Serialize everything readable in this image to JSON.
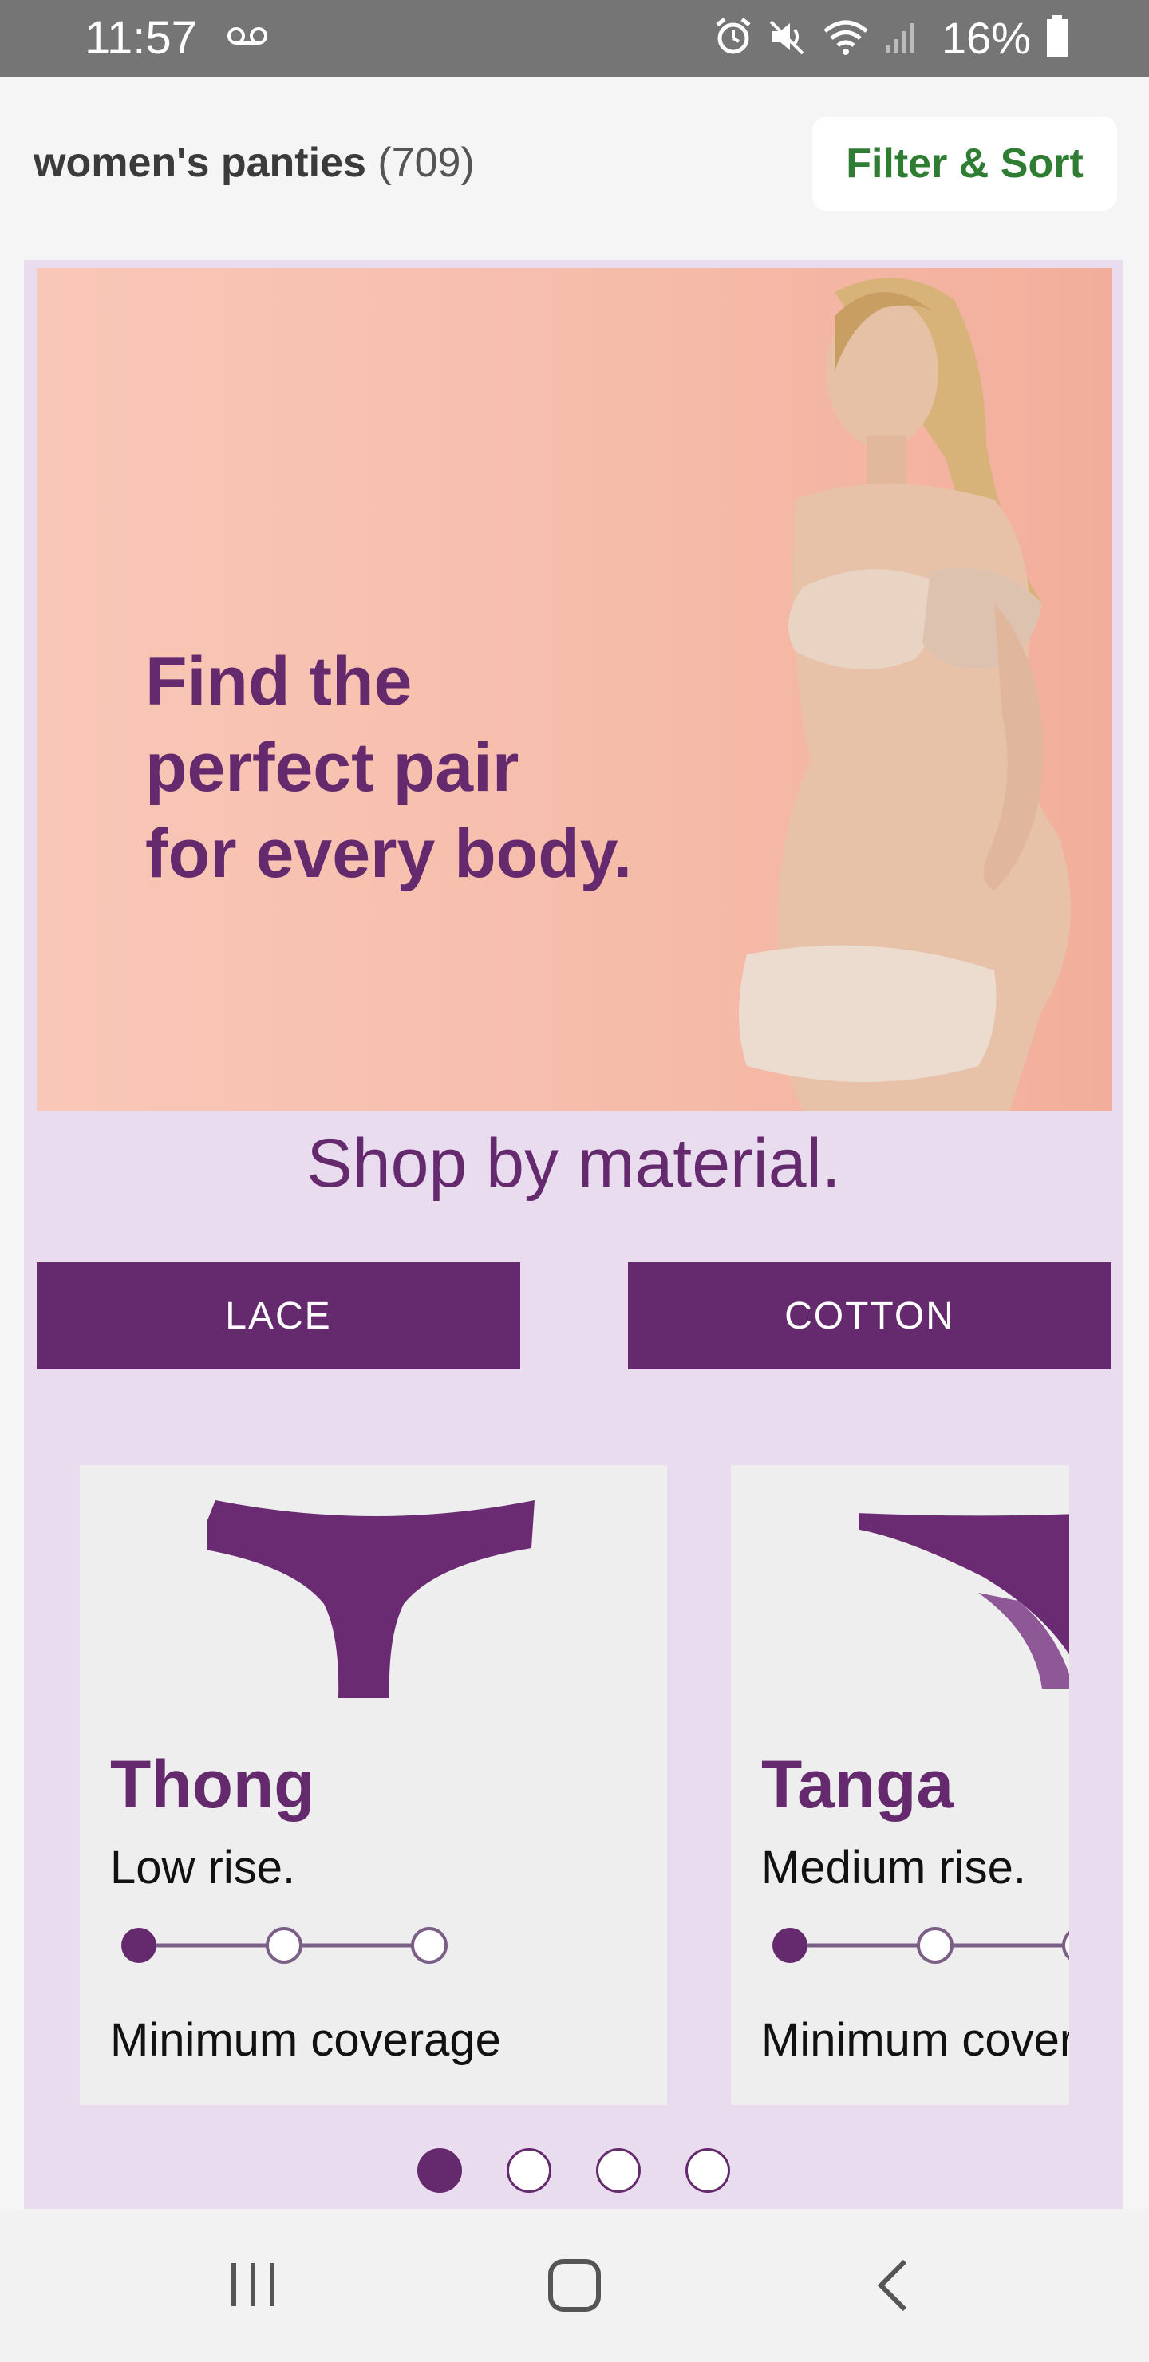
{
  "status_bar": {
    "time": "11:57",
    "battery": "16%",
    "icons": [
      "voicemail-icon",
      "alarm-icon",
      "mute-icon",
      "wifi-icon",
      "signal-icon",
      "battery-icon"
    ]
  },
  "header": {
    "title": "women's panties",
    "count": "(709)",
    "filter_label": "Filter & Sort",
    "filter_color": "#2e7d32"
  },
  "hero": {
    "lines": [
      "Find the",
      "perfect pair",
      "for every body."
    ]
  },
  "section": {
    "title": "Shop by material."
  },
  "materials": [
    "LACE",
    "COTTON"
  ],
  "cards": [
    {
      "name": "Thong",
      "rise": "Low rise.",
      "coverage": "Minimum coverage",
      "level": 1,
      "max_level": 3
    },
    {
      "name": "Tanga",
      "rise": "Medium rise.",
      "coverage": "Minimum coverage",
      "level": 1,
      "max_level": 3
    }
  ],
  "carousel": {
    "pages": 4,
    "active": 1
  },
  "navbar": [
    "recent-apps-icon",
    "home-icon",
    "back-icon"
  ],
  "colors": {
    "brand": "#652a6e",
    "panel": "#e8dcee",
    "hero_bg": "#f6bcaa"
  }
}
